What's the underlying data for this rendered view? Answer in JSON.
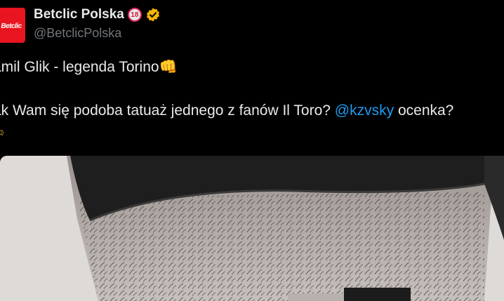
{
  "account": {
    "display_name": "Betclic Polska",
    "age_badge": "18",
    "handle": "@BetclicPolska",
    "avatar_text": "Betclic",
    "avatar_color": "#e8141f",
    "verified_color": "#f4b400"
  },
  "post": {
    "line1_text": "amil Glik - legenda Torino",
    "line1_emoji": "👊",
    "line2_prefix": "ak Wam się podoba tatuaż jednego z fanów Il Toro? ",
    "line2_mention": "@kzvsky",
    "line2_suffix": " ocenka?",
    "line3_emoji": "✍"
  },
  "colors": {
    "background": "#000000",
    "text": "#e7e9ea",
    "secondary_text": "#71767b",
    "mention": "#1d9bf0"
  }
}
